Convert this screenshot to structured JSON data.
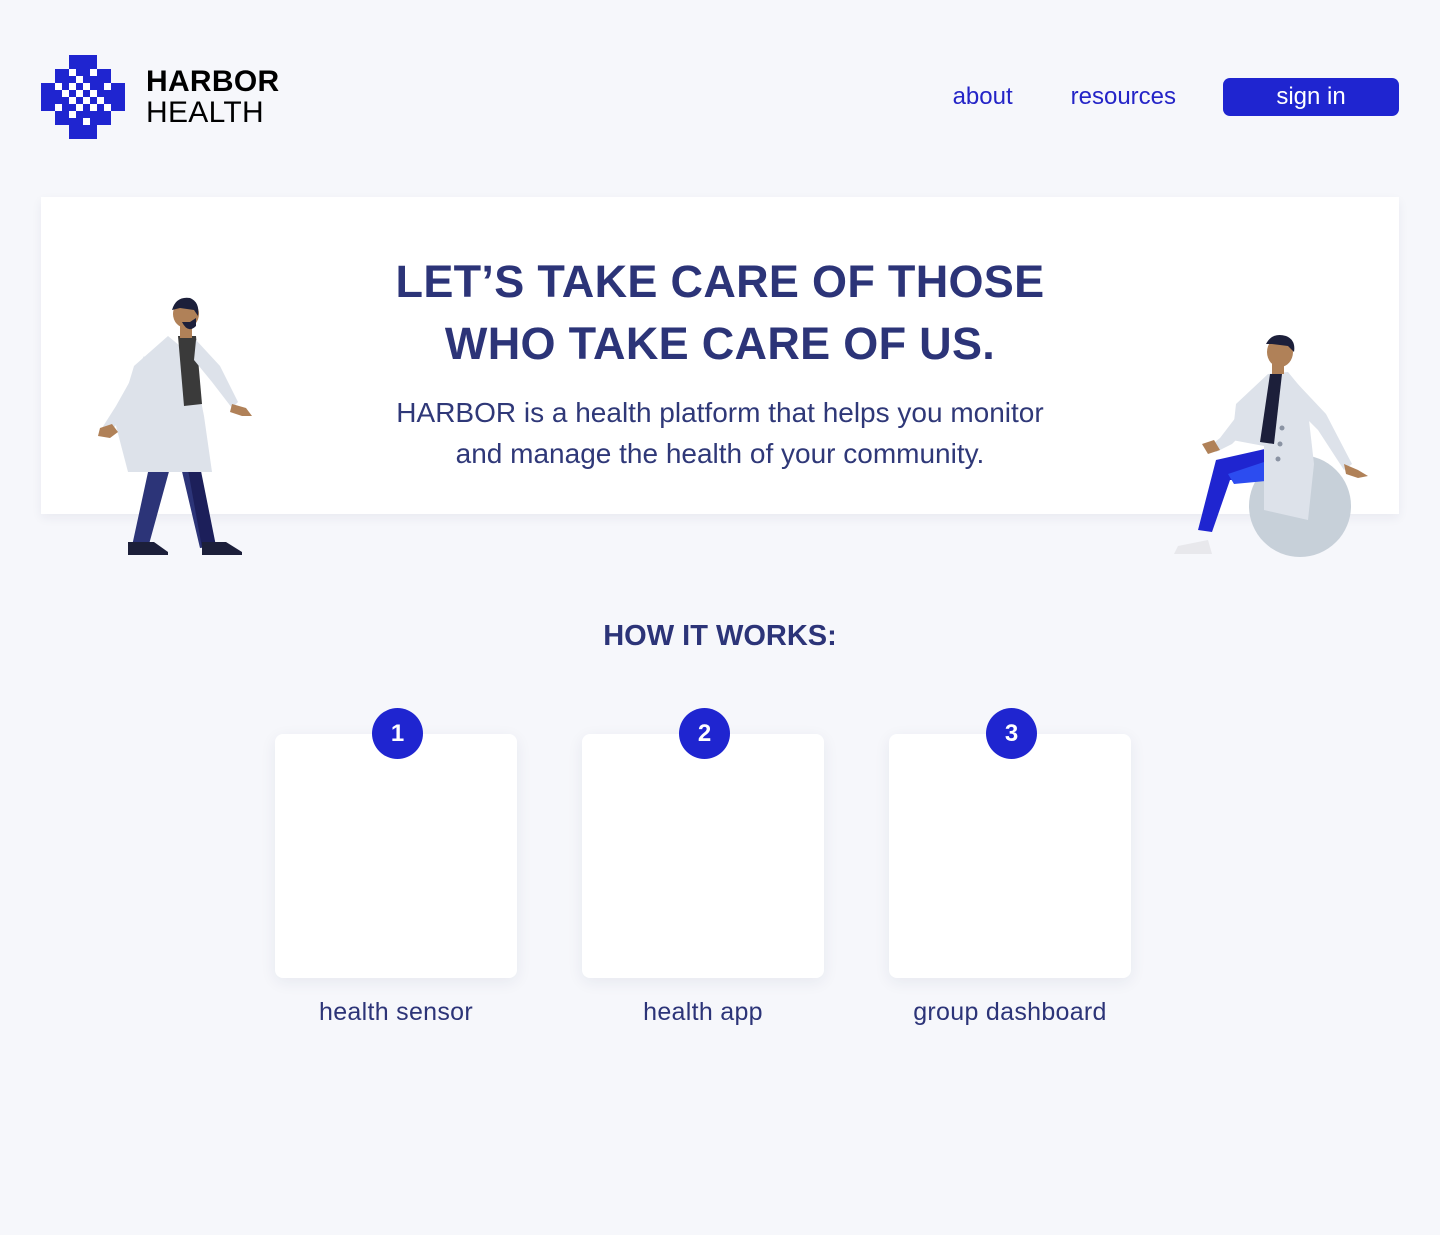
{
  "brand": {
    "line1": "HARBOR",
    "line2": "HEALTH",
    "color": "#1f25d0"
  },
  "nav": {
    "about": "about",
    "resources": "resources",
    "sign_in": "sign in"
  },
  "hero": {
    "title_line1": "LET’S TAKE CARE OF THOSE",
    "title_line2": "WHO TAKE CARE OF US.",
    "subtitle_line1": "HARBOR is a health platform that helps you monitor",
    "subtitle_line2": "and manage the health of your community."
  },
  "how_it_works": {
    "title": "HOW IT WORKS:",
    "steps": [
      {
        "number": "1",
        "label": "health sensor"
      },
      {
        "number": "2",
        "label": "health app"
      },
      {
        "number": "3",
        "label": "group dashboard"
      }
    ]
  },
  "colors": {
    "accent": "#1f25d0",
    "heading": "#2c3478",
    "background": "#f6f7fb"
  }
}
